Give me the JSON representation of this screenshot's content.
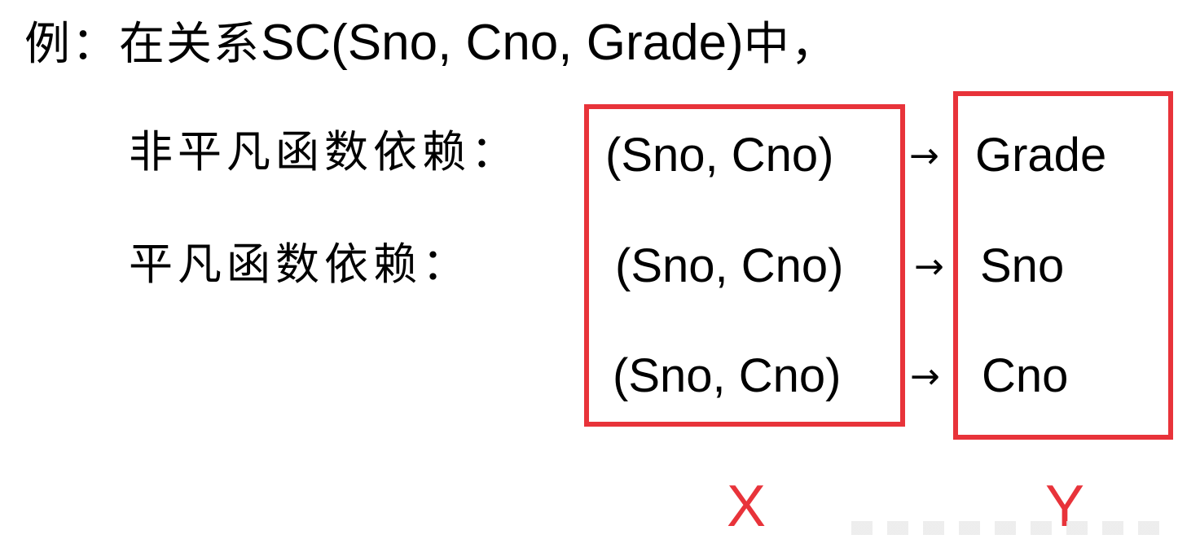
{
  "heading": {
    "prefix": "例：在关系",
    "relation": "SC(Sno, Cno, Grade)",
    "suffix": "中，"
  },
  "labels": {
    "nontrivial": "非平凡函数依赖：",
    "trivial": "平凡函数依赖："
  },
  "dependencies": [
    {
      "lhs": "(Sno, Cno)",
      "arrow": "→",
      "rhs": "Grade"
    },
    {
      "lhs": "(Sno, Cno)",
      "arrow": "→",
      "rhs": "Sno"
    },
    {
      "lhs": "(Sno, Cno)",
      "arrow": "→",
      "rhs": "Cno"
    }
  ],
  "sets": {
    "x": "X",
    "y": "Y"
  },
  "colors": {
    "text": "#000000",
    "accent": "#e8333a",
    "background": "#ffffff"
  }
}
